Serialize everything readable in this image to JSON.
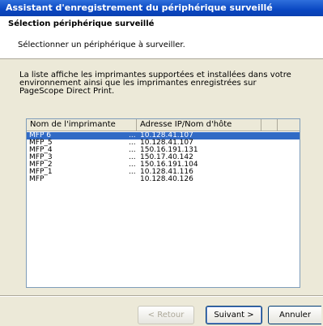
{
  "window": {
    "title": "Assistant d'enregistrement du périphérique surveillé"
  },
  "header": {
    "title": "Sélection périphérique surveillé",
    "subtitle": "Sélectionner un périphérique à surveiller."
  },
  "description": "La liste affiche les imprimantes supportées et installées dans votre environnement ainsi que les imprimantes enregistrées sur PageScope Direct Print.",
  "list": {
    "columns": [
      "Nom de l'imprimante",
      "Adresse IP/Nom d'hôte",
      ""
    ],
    "rows": [
      {
        "name": "MFP 6",
        "dots": "...",
        "address": "10.128.41.107",
        "selected": true
      },
      {
        "name": "MFP_5",
        "dots": "...",
        "address": "10.128.41.107"
      },
      {
        "name": "MFP_4",
        "dots": "...",
        "address": "150.16.191.131"
      },
      {
        "name": "MFP_3",
        "dots": "...",
        "address": "150.17.40.142"
      },
      {
        "name": "MFP_2",
        "dots": "...",
        "address": "150.16.191.104"
      },
      {
        "name": "MFP_1",
        "dots": "...",
        "address": "10.128.41.116"
      },
      {
        "name": "MFP",
        "dots": "",
        "address": "10.128.40.126"
      }
    ]
  },
  "buttons": {
    "back": "< Retour",
    "next": "Suivant >",
    "cancel": "Annuler"
  }
}
